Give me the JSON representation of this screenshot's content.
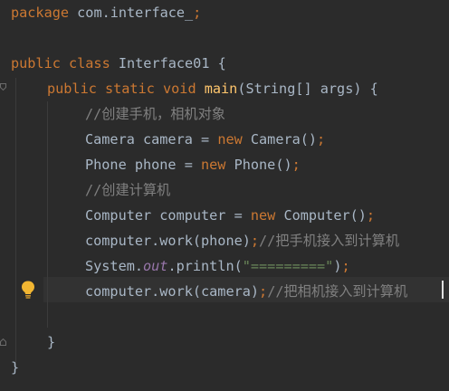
{
  "code": {
    "l1": {
      "kw": "package",
      "rest": " com.interface_",
      "semi": ";"
    },
    "l3": {
      "kw": "public class",
      "rest": " Interface01 {"
    },
    "l4": {
      "kw": "public static void",
      "fn": "main",
      "rest": "(String[] args) {"
    },
    "l5": {
      "comment": "//创建手机，相机对象"
    },
    "l6": {
      "pre": "Camera camera = ",
      "kw": "new",
      "post": " Camera()",
      "semi": ";"
    },
    "l7": {
      "pre": "Phone phone = ",
      "kw": "new",
      "post": " Phone()",
      "semi": ";"
    },
    "l8": {
      "comment": "//创建计算机"
    },
    "l9": {
      "pre": "Computer computer = ",
      "kw": "new",
      "post": " Computer()",
      "semi": ";"
    },
    "l10": {
      "code": "computer.work(phone)",
      "semi": ";",
      "comment": "//把手机接入到计算机"
    },
    "l11": {
      "pre": "System.",
      "field": "out",
      "mid": ".println(",
      "str": "\"=========\"",
      "post": ")",
      "semi": ";"
    },
    "l12": {
      "code": "computer.work(camera)",
      "semi": ";",
      "comment": "//把相机接入到计算机"
    },
    "l14": {
      "brace": "}"
    },
    "l15": {
      "brace": "}"
    }
  },
  "icons": {
    "intention": "lightbulb-icon",
    "fold": "fold-marker-icon"
  },
  "colors": {
    "background": "#2b2b2b",
    "keyword": "#cc7832",
    "method": "#ffc66d",
    "comment": "#808080",
    "string": "#6a8759",
    "static_field": "#9876aa",
    "text": "#a9b7c6",
    "bulb": "#f2b632"
  }
}
